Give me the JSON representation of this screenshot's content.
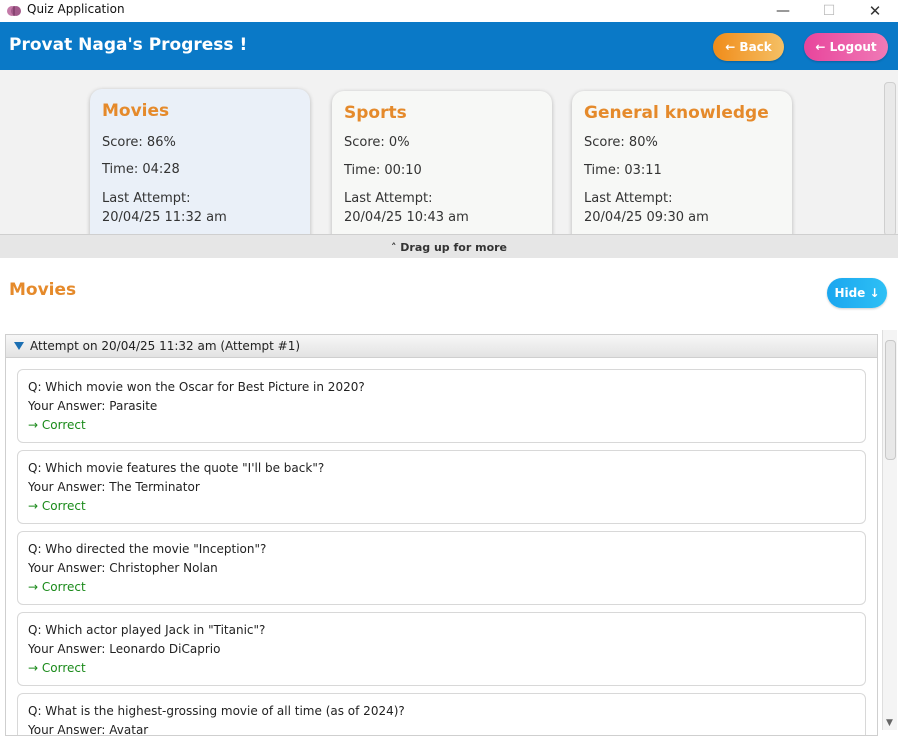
{
  "window": {
    "title": "Quiz Application",
    "icon": "brain-icon"
  },
  "header": {
    "title": "Provat Naga's Progress !",
    "back_label": "← Back",
    "logout_label": "← Logout"
  },
  "summary_cards": [
    {
      "title": "Movies",
      "score": "Score: 86%",
      "time": "Time: 04:28",
      "last_attempt_label": "Last Attempt:",
      "last_attempt": "20/04/25 11:32 am"
    },
    {
      "title": "Sports",
      "score": "Score: 0%",
      "time": "Time: 00:10",
      "last_attempt_label": "Last Attempt:",
      "last_attempt": "20/04/25 10:43 am"
    },
    {
      "title": "General knowledge",
      "score": "Score: 80%",
      "time": "Time: 03:11",
      "last_attempt_label": "Last Attempt:",
      "last_attempt": "20/04/25 09:30 am"
    }
  ],
  "drag_bar": {
    "label": "˄ Drag up for more"
  },
  "details": {
    "title": "Movies",
    "hide_label": "Hide ↓",
    "attempt_header": "Attempt on 20/04/25 11:32 am (Attempt #1)",
    "questions": [
      {
        "q": "Q: Which movie won the Oscar for Best Picture in 2020?",
        "answer": "Your Answer: Parasite",
        "result": "→ Correct"
      },
      {
        "q": "Q: Which movie features the quote \"I'll be back\"?",
        "answer": "Your Answer: The Terminator",
        "result": "→ Correct"
      },
      {
        "q": "Q: Who directed the movie \"Inception\"?",
        "answer": "Your Answer: Christopher Nolan",
        "result": "→ Correct"
      },
      {
        "q": "Q: Which actor played Jack in \"Titanic\"?",
        "answer": "Your Answer: Leonardo DiCaprio",
        "result": "→ Correct"
      },
      {
        "q": "Q: What is the highest-grossing movie of all time (as of 2024)?",
        "answer": "Your Answer: Avatar",
        "result": ""
      }
    ]
  },
  "colors": {
    "header_bg": "#0a79c7",
    "accent_orange": "#e58a2b",
    "correct_green": "#1a8a1a"
  }
}
